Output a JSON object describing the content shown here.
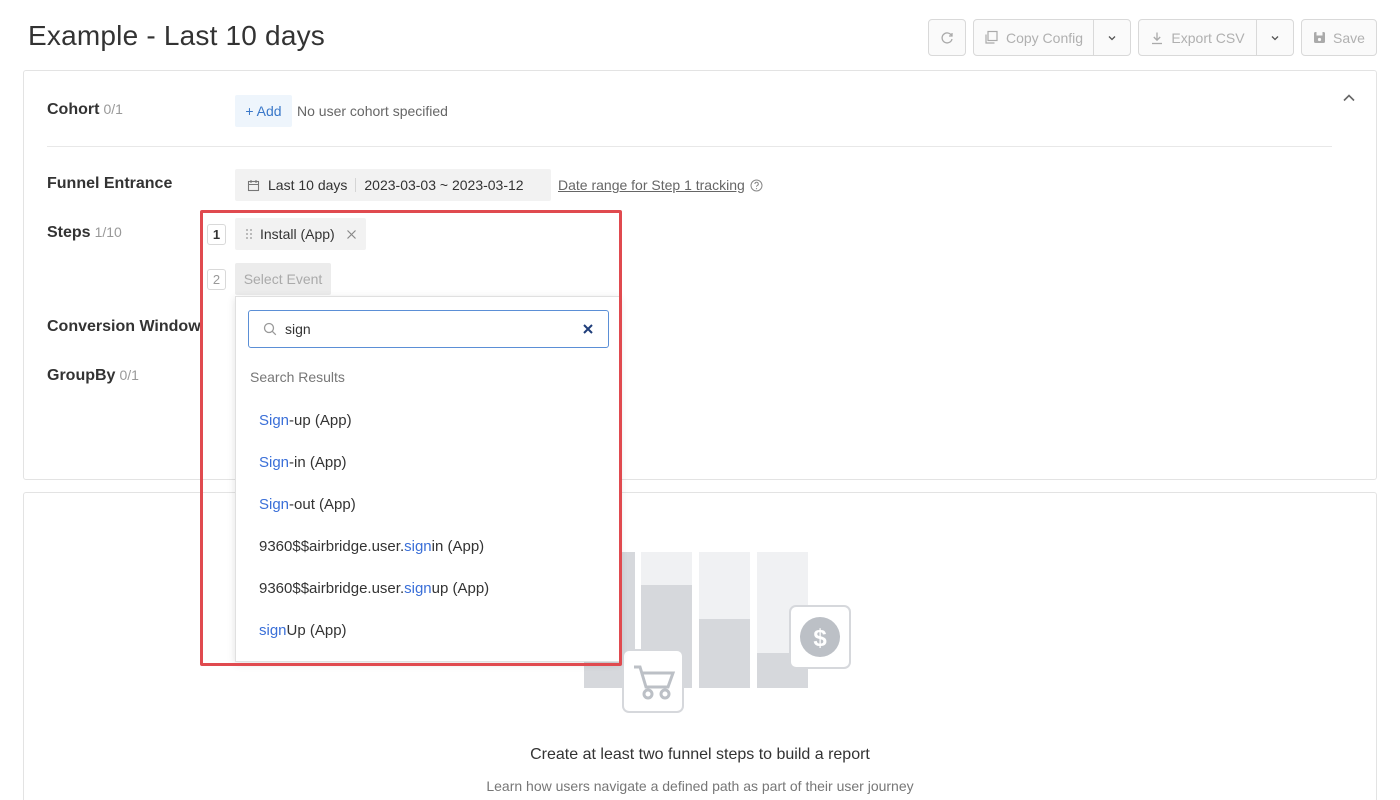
{
  "page": {
    "title": "Example - Last 10 days"
  },
  "toolbar": {
    "copy_config_label": "Copy Config",
    "export_csv_label": "Export CSV",
    "save_label": "Save"
  },
  "cohort": {
    "label": "Cohort",
    "count": "0/1",
    "add_label": "+ Add",
    "empty_text": "No user cohort specified"
  },
  "funnel_entrance": {
    "label": "Funnel Entrance",
    "range_label": "Last 10 days",
    "date_range": "2023-03-03 ~ 2023-03-12",
    "link_text": "Date range for Step 1 tracking"
  },
  "steps": {
    "label": "Steps",
    "count": "1/10",
    "items": [
      {
        "number": "1",
        "name": "Install (App)"
      }
    ],
    "next_number": "2",
    "select_placeholder": "Select Event"
  },
  "conversion_window": {
    "label": "Conversion Window"
  },
  "groupby": {
    "label": "GroupBy",
    "count": "0/1"
  },
  "search": {
    "value": "sign",
    "results_title": "Search Results",
    "results": [
      {
        "pre": "",
        "match": "Sign",
        "post": "-up (App)"
      },
      {
        "pre": "",
        "match": "Sign",
        "post": "-in (App)"
      },
      {
        "pre": "",
        "match": "Sign",
        "post": "-out (App)"
      },
      {
        "pre": "9360$$airbridge.user.",
        "match": "sign",
        "post": "in (App)"
      },
      {
        "pre": "9360$$airbridge.user.",
        "match": "sign",
        "post": "up (App)"
      },
      {
        "pre": "",
        "match": "sign",
        "post": "Up (App)"
      }
    ]
  },
  "empty_state": {
    "title": "Create at least two funnel steps to build a report",
    "subtitle": "Learn how users navigate a defined path as part of their user journey"
  },
  "colors": {
    "accent": "#3a6fd8",
    "highlight_border": "#e04a4f",
    "search_border": "#5b8fd6"
  }
}
